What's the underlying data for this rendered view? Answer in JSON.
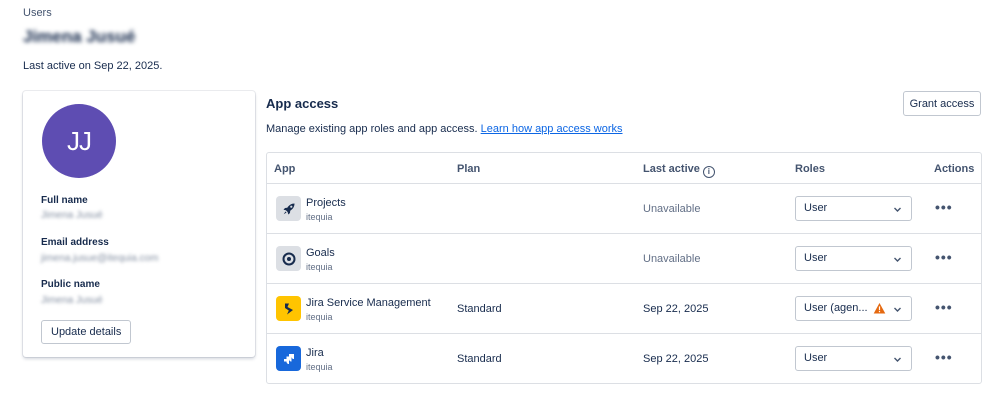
{
  "header": {
    "breadcrumb": "Users",
    "title": "Jimena Jusué",
    "last_active": "Last active on Sep 22, 2025."
  },
  "profile": {
    "initials": "JJ",
    "avatar_color": "#5e4db2",
    "full_name_label": "Full name",
    "full_name_value": "Jimena Jusué",
    "email_label": "Email address",
    "email_value": "jimena.jusue@itequia.com",
    "public_name_label": "Public name",
    "public_name_value": "Jimena Jusué",
    "update_button": "Update details"
  },
  "app_access": {
    "title": "App access",
    "grant_button": "Grant access",
    "description": "Manage existing app roles and app access.",
    "learn_link": "Learn how app access works",
    "columns": {
      "app": "App",
      "plan": "Plan",
      "last_active": "Last active",
      "roles": "Roles",
      "actions": "Actions"
    },
    "rows": [
      {
        "name": "Projects",
        "site": "itequia",
        "plan": "",
        "last_active": "Unavailable",
        "role": "User",
        "icon": "rocket-icon",
        "icon_bg": "#dcdfe4"
      },
      {
        "name": "Goals",
        "site": "itequia",
        "plan": "",
        "last_active": "Unavailable",
        "role": "User",
        "icon": "target-icon",
        "icon_bg": "#dcdfe4"
      },
      {
        "name": "Jira Service Management",
        "site": "itequia",
        "plan": "Standard",
        "last_active": "Sep 22, 2025",
        "role": "User (agen...",
        "icon": "lightning-icon",
        "icon_bg": "#ffc400",
        "warning": true
      },
      {
        "name": "Jira",
        "site": "itequia",
        "plan": "Standard",
        "last_active": "Sep 22, 2025",
        "role": "User",
        "icon": "jira-icon",
        "icon_bg": "#1868db"
      }
    ],
    "actions_glyph": "•••"
  }
}
